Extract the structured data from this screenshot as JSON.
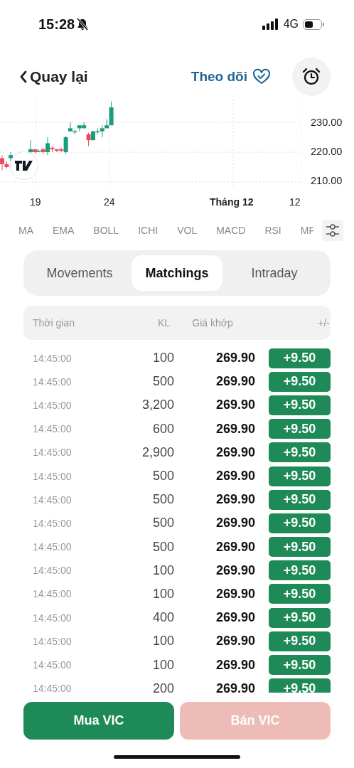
{
  "status_bar": {
    "time": "15:28",
    "network": "4G"
  },
  "nav": {
    "back": "Quay lại",
    "follow": "Theo dõi"
  },
  "chart": {
    "y_labels": [
      "230.00",
      "220.00",
      "210.00"
    ],
    "x_labels": [
      "19",
      "24",
      "Tháng 12",
      "12"
    ]
  },
  "indicators": [
    "MA",
    "EMA",
    "BOLL",
    "ICHI",
    "VOL",
    "MACD",
    "RSI",
    "MF"
  ],
  "tabs": [
    {
      "label": "Movements",
      "selected": false
    },
    {
      "label": "Matchings",
      "selected": true
    },
    {
      "label": "Intraday",
      "selected": false
    }
  ],
  "table": {
    "columns": [
      "Thời gian",
      "KL",
      "Giá khớp",
      "+/-"
    ],
    "rows": [
      {
        "time": "14:45:00",
        "volume": "100",
        "price": "269.90",
        "change": "+9.50"
      },
      {
        "time": "14:45:00",
        "volume": "500",
        "price": "269.90",
        "change": "+9.50"
      },
      {
        "time": "14:45:00",
        "volume": "3,200",
        "price": "269.90",
        "change": "+9.50"
      },
      {
        "time": "14:45:00",
        "volume": "600",
        "price": "269.90",
        "change": "+9.50"
      },
      {
        "time": "14:45:00",
        "volume": "2,900",
        "price": "269.90",
        "change": "+9.50"
      },
      {
        "time": "14:45:00",
        "volume": "500",
        "price": "269.90",
        "change": "+9.50"
      },
      {
        "time": "14:45:00",
        "volume": "500",
        "price": "269.90",
        "change": "+9.50"
      },
      {
        "time": "14:45:00",
        "volume": "500",
        "price": "269.90",
        "change": "+9.50"
      },
      {
        "time": "14:45:00",
        "volume": "500",
        "price": "269.90",
        "change": "+9.50"
      },
      {
        "time": "14:45:00",
        "volume": "100",
        "price": "269.90",
        "change": "+9.50"
      },
      {
        "time": "14:45:00",
        "volume": "100",
        "price": "269.90",
        "change": "+9.50"
      },
      {
        "time": "14:45:00",
        "volume": "400",
        "price": "269.90",
        "change": "+9.50"
      },
      {
        "time": "14:45:00",
        "volume": "100",
        "price": "269.90",
        "change": "+9.50"
      },
      {
        "time": "14:45:00",
        "volume": "100",
        "price": "269.90",
        "change": "+9.50"
      },
      {
        "time": "14:45:00",
        "volume": "200",
        "price": "269.90",
        "change": "+9.50"
      }
    ]
  },
  "actions": [
    {
      "label": "Mua VIC",
      "kind": "buy",
      "disabled": false
    },
    {
      "label": "Bán VIC",
      "kind": "sell",
      "disabled": true
    }
  ]
}
